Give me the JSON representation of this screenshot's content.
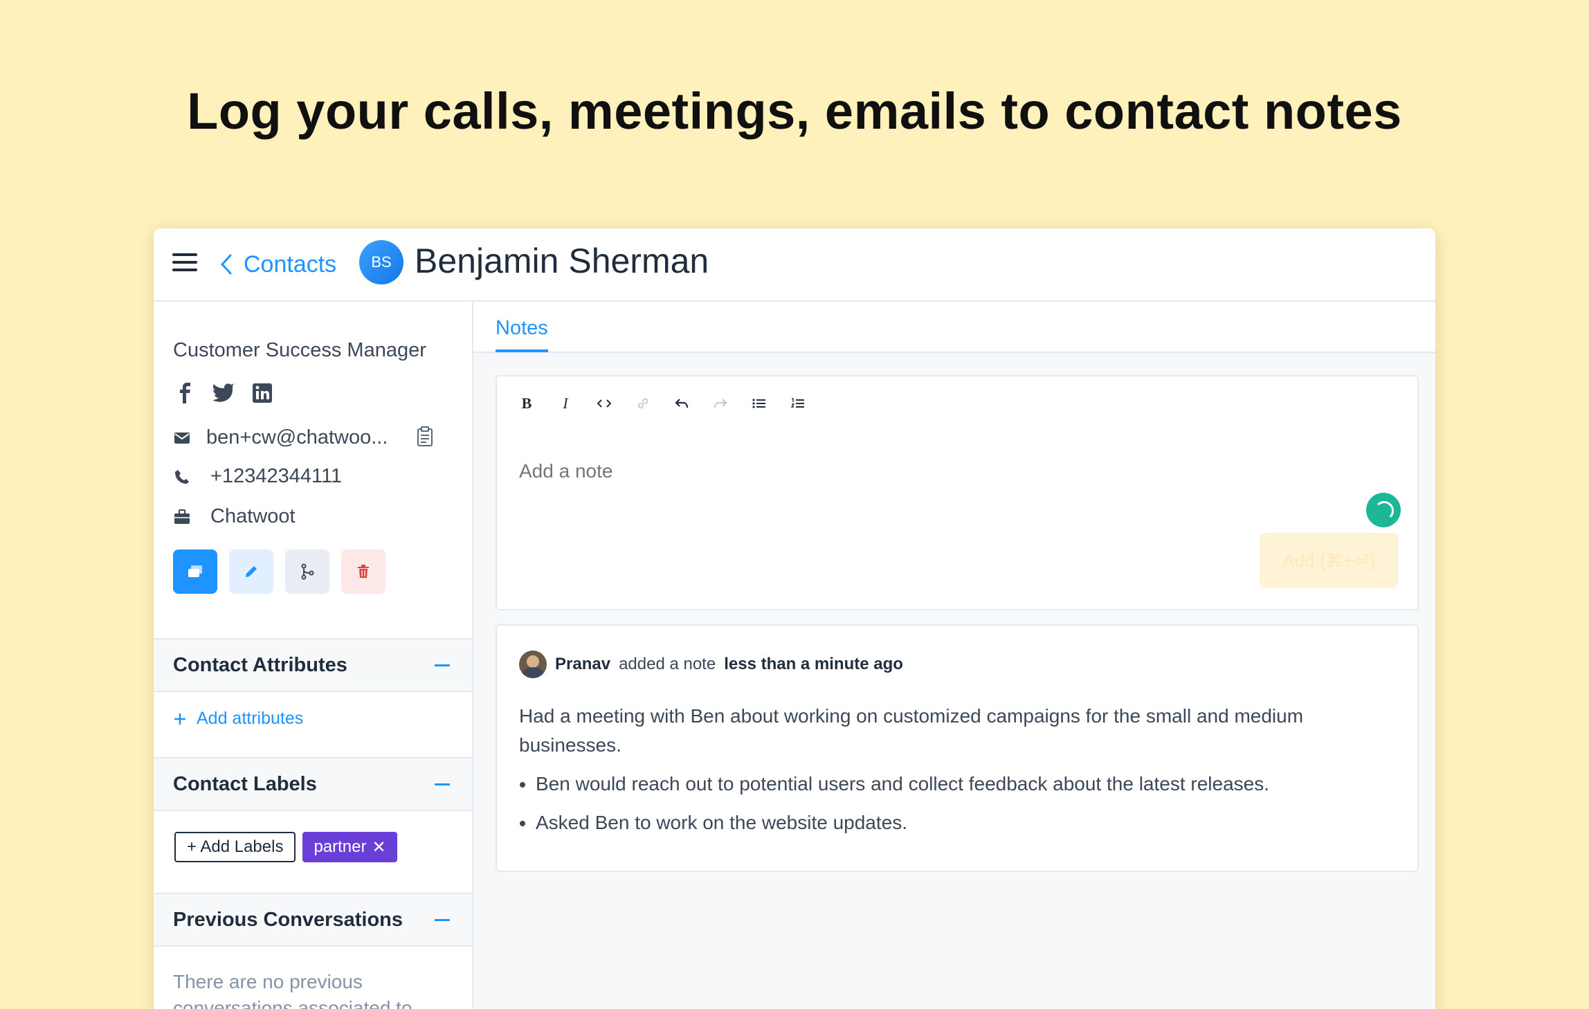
{
  "headline": "Log your calls, meetings, emails to contact notes",
  "header": {
    "back_label": "Contacts",
    "avatar_initials": "BS",
    "contact_name": "Benjamin Sherman"
  },
  "sidebar": {
    "job_title": "Customer Success Manager",
    "social_icons": [
      "facebook-icon",
      "twitter-icon",
      "linkedin-icon"
    ],
    "email": "ben+cw@chatwoo...",
    "phone": "+12342344111",
    "company": "Chatwoot",
    "actions": [
      "new-conversation",
      "edit",
      "merge",
      "delete"
    ],
    "sections": {
      "attributes": {
        "title": "Contact Attributes",
        "add_label": "Add attributes"
      },
      "labels": {
        "title": "Contact Labels",
        "add_label": "+ Add Labels",
        "items": [
          "partner"
        ]
      },
      "previous": {
        "title": "Previous Conversations",
        "empty_text": "There are no previous conversations associated to"
      }
    }
  },
  "main": {
    "tab": "Notes",
    "editor": {
      "placeholder": "Add a note",
      "add_button": "Add (⌘+⏎)"
    },
    "note": {
      "author": "Pranav",
      "action": "added a note",
      "time": "less than a minute ago",
      "body": "Had a meeting with Ben about working on customized campaigns for the small and medium businesses.",
      "bullets": [
        "Ben would reach out to potential users and collect feedback about the latest releases.",
        "Asked Ben to work on the website updates."
      ]
    }
  },
  "colors": {
    "background": "#fef1bc",
    "accent": "#1f93ff",
    "label_partner": "#6a3fd8",
    "spinner": "#1cb796"
  }
}
